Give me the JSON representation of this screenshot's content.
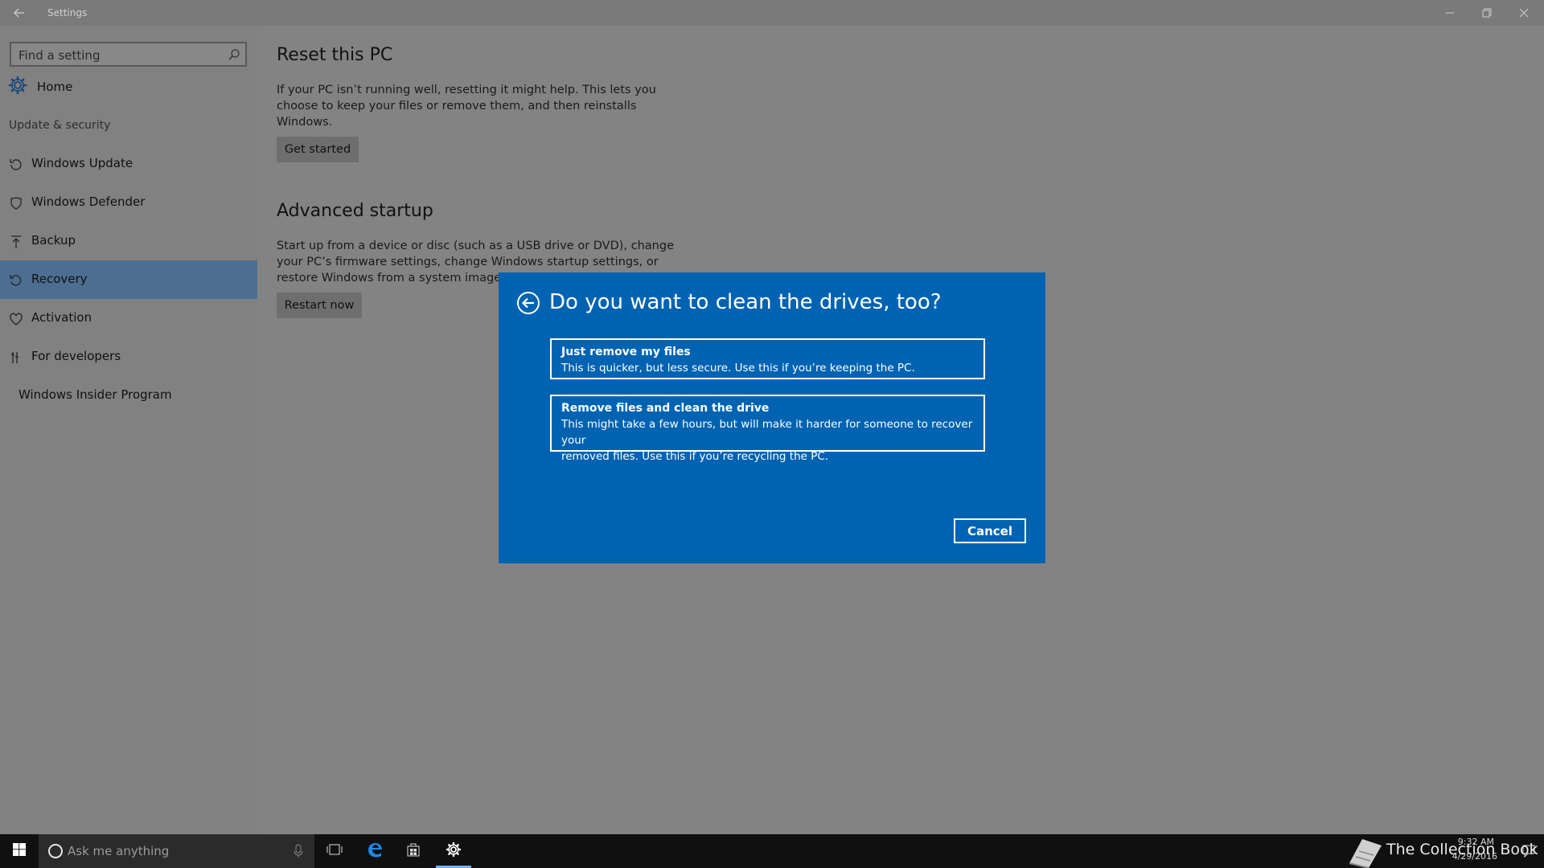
{
  "window": {
    "title": "Settings"
  },
  "sidebar": {
    "search_placeholder": "Find a setting",
    "home_label": "Home",
    "section_label": "Update & security",
    "items": [
      {
        "label": "Windows Update",
        "icon": "refresh-icon"
      },
      {
        "label": "Windows Defender",
        "icon": "shield-icon"
      },
      {
        "label": "Backup",
        "icon": "upload-icon"
      },
      {
        "label": "Recovery",
        "icon": "history-icon",
        "active": true
      },
      {
        "label": "Activation",
        "icon": "heart-check-icon"
      },
      {
        "label": "For developers",
        "icon": "tools-icon"
      },
      {
        "label": "Windows Insider Program",
        "icon": ""
      }
    ]
  },
  "main": {
    "reset": {
      "title": "Reset this PC",
      "description_lines": [
        "If your PC isn’t running well, resetting it might help. This lets you",
        "choose to keep your files or remove them, and then reinstalls",
        "Windows."
      ],
      "button": "Get started"
    },
    "advanced": {
      "title": "Advanced startup",
      "description_lines": [
        "Start up from a device or disc (such as a USB drive or DVD), change",
        "your PC’s firmware settings, change Windows startup settings, or",
        "restore Windows from a system image. Th"
      ],
      "button": "Restart now"
    }
  },
  "dialog": {
    "title": "Do you want to clean the drives, too?",
    "options": [
      {
        "title": "Just remove my files",
        "description_lines": [
          "This is quicker, but less secure. Use this if you’re keeping the PC."
        ]
      },
      {
        "title": "Remove files and clean the drive",
        "description_lines": [
          "This might take a few hours, but will make it harder for someone to recover your",
          "removed files. Use this if you’re recycling the PC."
        ]
      }
    ],
    "cancel": "Cancel"
  },
  "taskbar": {
    "search_placeholder": "Ask me anything",
    "watermark": "The Collection Book",
    "time": "9:32 AM",
    "date": "4/29/2016"
  },
  "colors": {
    "dialog_bg": "#0063b1",
    "active_nav": "#4b6e91",
    "taskbar": "#101010",
    "accent": "#6cb2ff"
  }
}
